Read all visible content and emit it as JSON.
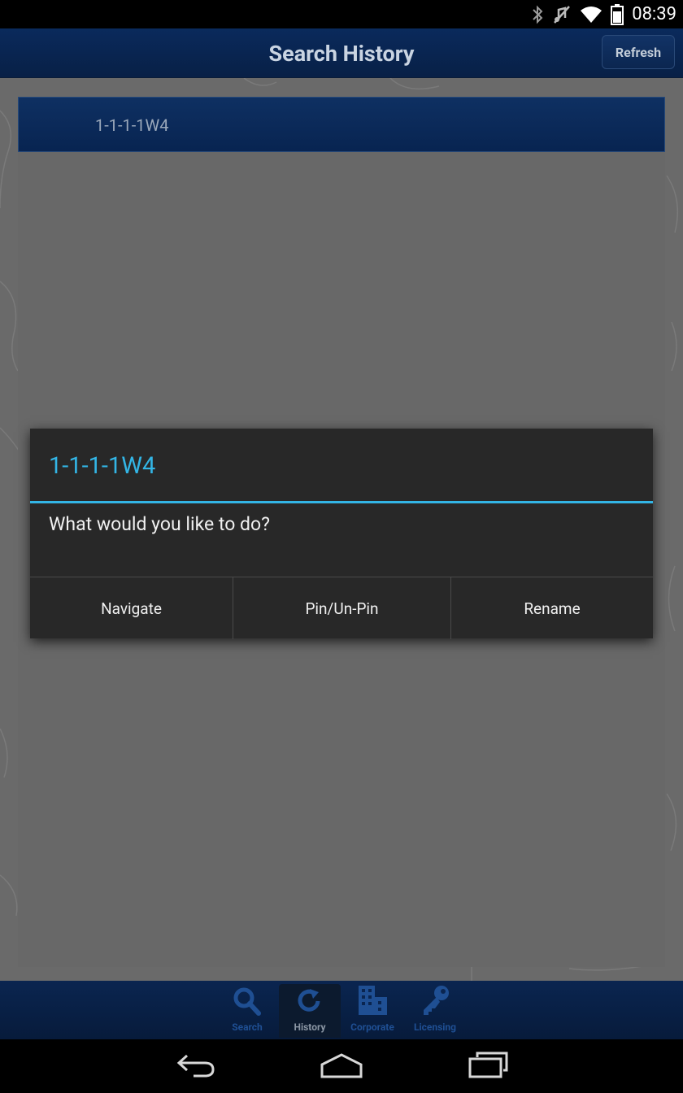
{
  "status_bar": {
    "time": "08:39",
    "icons": [
      "bluetooth-icon",
      "mute-icon",
      "wifi-icon",
      "battery-icon"
    ]
  },
  "action_bar": {
    "title": "Search History",
    "refresh_label": "Refresh"
  },
  "history": {
    "items": [
      {
        "label": "1-1-1-1W4"
      }
    ]
  },
  "dialog": {
    "title": "1-1-1-1W4",
    "message": "What would you like to do?",
    "buttons": [
      "Navigate",
      "Pin/Un-Pin",
      "Rename"
    ]
  },
  "tab_bar": {
    "tabs": [
      {
        "label": "Search",
        "icon": "search-icon",
        "active": false
      },
      {
        "label": "History",
        "icon": "refresh-icon",
        "active": true
      },
      {
        "label": "Corporate",
        "icon": "building-icon",
        "active": false
      },
      {
        "label": "Licensing",
        "icon": "key-icon",
        "active": false
      }
    ]
  },
  "nav_bar": {
    "buttons": [
      "back-icon",
      "home-icon",
      "recents-icon"
    ]
  },
  "colors": {
    "accent": "#33b5e5",
    "action_bar": "#0a2a5c",
    "dialog_bg": "#282828"
  }
}
